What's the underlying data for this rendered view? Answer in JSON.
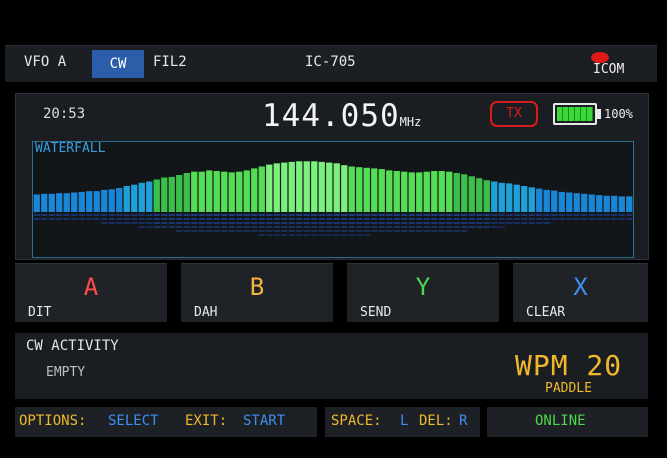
{
  "top_bar": {
    "vfo": "VFO A",
    "mode": "CW",
    "filter": "FIL2",
    "model": "IC-705",
    "logo": "ICOM"
  },
  "status": {
    "time": "20:53",
    "frequency": "144.050",
    "frequency_unit": "MHz",
    "tx": "TX",
    "battery_label": "100%",
    "battery_level": 1.0
  },
  "waterfall": {
    "label": "WATERFALL",
    "levels": [
      0.27,
      0.28,
      0.28,
      0.29,
      0.29,
      0.3,
      0.31,
      0.32,
      0.32,
      0.34,
      0.35,
      0.37,
      0.4,
      0.42,
      0.45,
      0.47,
      0.5,
      0.53,
      0.54,
      0.57,
      0.6,
      0.62,
      0.62,
      0.64,
      0.63,
      0.62,
      0.61,
      0.62,
      0.64,
      0.67,
      0.7,
      0.73,
      0.75,
      0.76,
      0.77,
      0.78,
      0.78,
      0.78,
      0.77,
      0.76,
      0.75,
      0.72,
      0.7,
      0.69,
      0.68,
      0.67,
      0.66,
      0.64,
      0.63,
      0.62,
      0.61,
      0.61,
      0.62,
      0.63,
      0.63,
      0.62,
      0.6,
      0.58,
      0.55,
      0.52,
      0.49,
      0.47,
      0.45,
      0.44,
      0.42,
      0.4,
      0.38,
      0.36,
      0.34,
      0.33,
      0.31,
      0.3,
      0.29,
      0.28,
      0.27,
      0.26,
      0.25,
      0.25,
      0.24,
      0.24
    ]
  },
  "buttons": [
    {
      "key": "A",
      "label": "DIT",
      "color": "#ff4b4b"
    },
    {
      "key": "B",
      "label": "DAH",
      "color": "#f3b43a"
    },
    {
      "key": "Y",
      "label": "SEND",
      "color": "#4cd74c"
    },
    {
      "key": "X",
      "label": "CLEAR",
      "color": "#3d8ff0"
    }
  ],
  "activity": {
    "title": "CW ACTIVITY",
    "content": "EMPTY",
    "wpm": "WPM 20",
    "input": "PADDLE"
  },
  "bottom_bar": {
    "options_label": "OPTIONS:",
    "options_value": "SELECT",
    "exit_label": "EXIT:",
    "exit_value": "START",
    "space_label": "SPACE:",
    "space_value": "L",
    "del_label": "DEL:",
    "del_value": "R",
    "status": "ONLINE"
  },
  "colors": {
    "accent_yellow": "#f0b82a",
    "accent_blue": "#3d8ff0",
    "accent_green": "#4cd74c",
    "tx_red": "#d81c1c"
  }
}
